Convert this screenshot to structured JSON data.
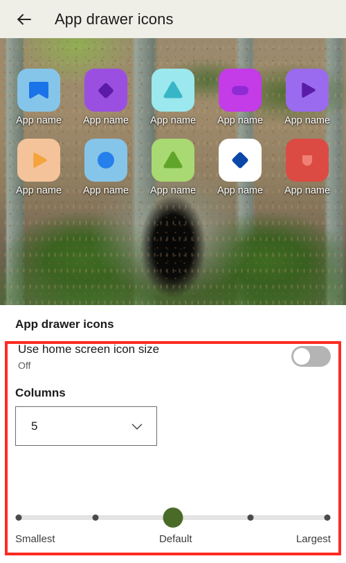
{
  "appbar": {
    "back_icon": "arrow-left-icon",
    "title": "App drawer icons"
  },
  "preview": {
    "wallpaper_description": "forest floor with mossy stone tunnel entrance",
    "rows": [
      [
        {
          "label": "App name",
          "tile_color": "#86C5EA",
          "glyph_color": "#1A73E8",
          "glyph": "banner-shape"
        },
        {
          "label": "App name",
          "tile_color": "#9B4FE0",
          "glyph_color": "#5B1BA8",
          "glyph": "diamond-shape"
        },
        {
          "label": "App name",
          "tile_color": "#9BE8EE",
          "glyph_color": "#38B6C8",
          "glyph": "triangle-shape"
        },
        {
          "label": "App name",
          "tile_color": "#C43BE8",
          "glyph_color": "#8E2BD4",
          "glyph": "pill-shape"
        },
        {
          "label": "App name",
          "tile_color": "#9A6BEE",
          "glyph_color": "#5B1BA8",
          "glyph": "play-shape"
        }
      ],
      [
        {
          "label": "App name",
          "tile_color": "#F4C39A",
          "glyph_color": "#F5A33C",
          "glyph": "play-shape"
        },
        {
          "label": "App name",
          "tile_color": "#86C5EA",
          "glyph_color": "#2680EB",
          "glyph": "circle-shape"
        },
        {
          "label": "App name",
          "tile_color": "#A8D972",
          "glyph_color": "#5FA52A",
          "glyph": "triangle-shape"
        },
        {
          "label": "App name",
          "tile_color": "#FFFFFF",
          "glyph_color": "#0B47A8",
          "glyph": "diamond-shape"
        },
        {
          "label": "App name",
          "tile_color": "#DC4B43",
          "glyph_color": "#F08076",
          "glyph": "dome-shape"
        }
      ]
    ]
  },
  "settings": {
    "section_title": "App drawer icons",
    "highlight_color": "#FF2A20",
    "use_home_icon_size": {
      "title": "Use home screen icon size",
      "summary": "Off",
      "toggle_state": "off"
    },
    "columns": {
      "label": "Columns",
      "value": "5",
      "chevron_icon": "chevron-down-icon"
    },
    "size_slider": {
      "value_index": 2,
      "tick_count": 5,
      "thumb_color": "#4A6B28",
      "legend_left": "Smallest",
      "legend_center": "Default",
      "legend_right": "Largest"
    }
  }
}
